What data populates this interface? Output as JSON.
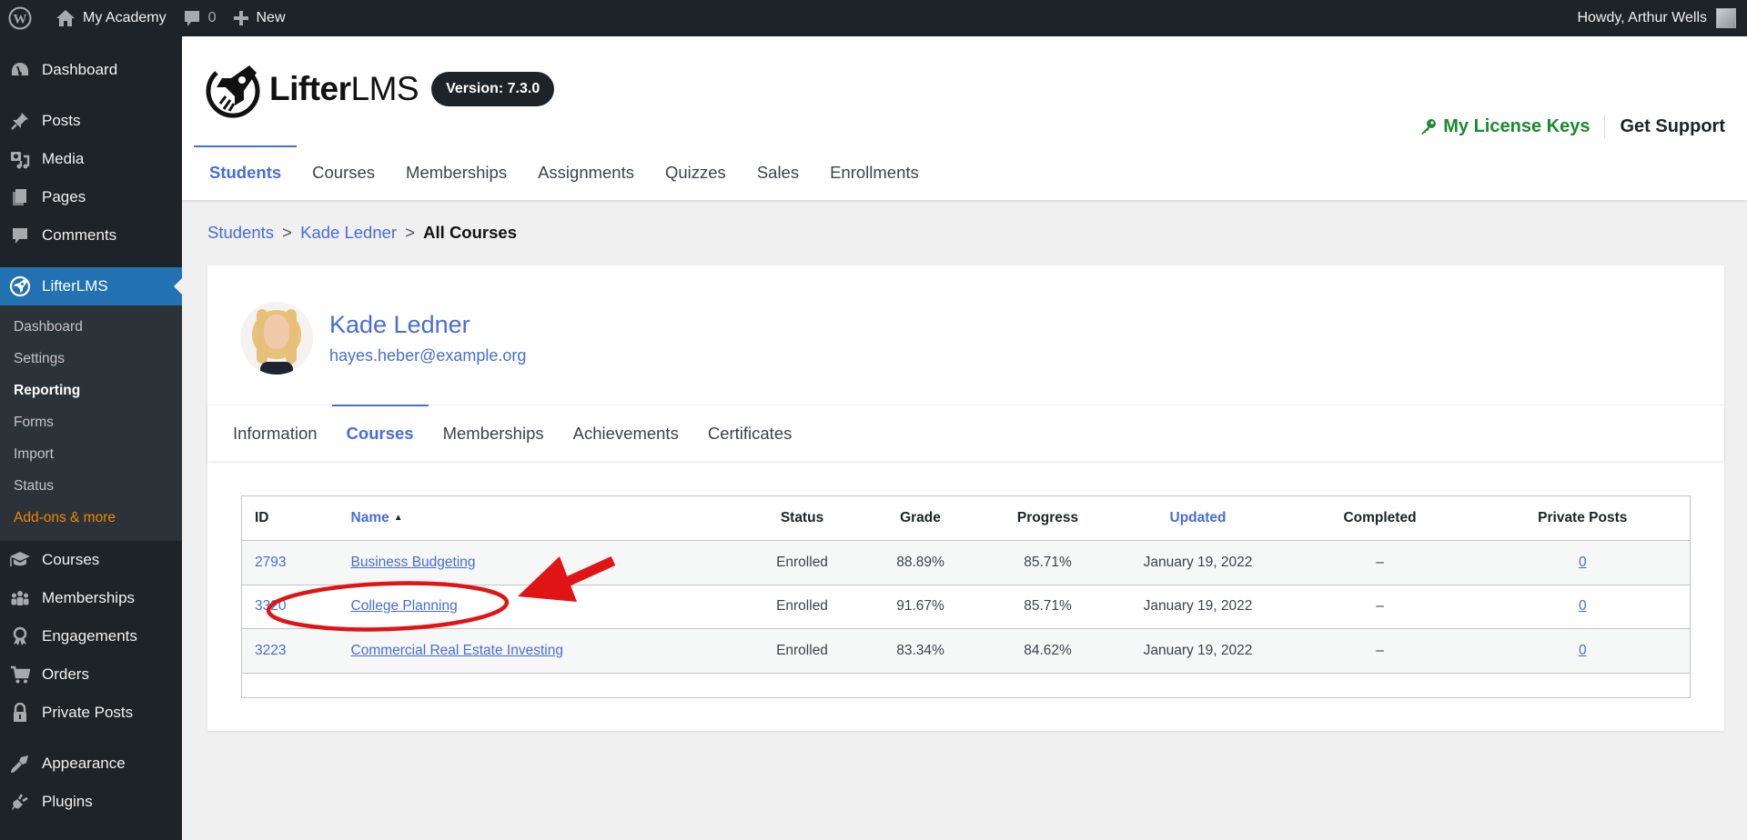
{
  "adminbar": {
    "site_name": "My Academy",
    "comments_count": "0",
    "new_label": "New",
    "howdy": "Howdy, Arthur Wells"
  },
  "sidebar": {
    "items": [
      {
        "label": "Dashboard",
        "icon": "dashboard-icon"
      },
      {
        "label": "Posts",
        "icon": "pushpin-icon"
      },
      {
        "label": "Media",
        "icon": "media-icon"
      },
      {
        "label": "Pages",
        "icon": "pages-icon"
      },
      {
        "label": "Comments",
        "icon": "comment-icon"
      },
      {
        "label": "LifterLMS",
        "icon": "lifterlms-rocket-icon",
        "active": true
      },
      {
        "label": "Courses",
        "icon": "graduation-cap-icon"
      },
      {
        "label": "Memberships",
        "icon": "groups-icon"
      },
      {
        "label": "Engagements",
        "icon": "award-icon"
      },
      {
        "label": "Orders",
        "icon": "cart-icon"
      },
      {
        "label": "Private Posts",
        "icon": "lock-icon"
      },
      {
        "label": "Appearance",
        "icon": "paintbrush-icon"
      },
      {
        "label": "Plugins",
        "icon": "plugin-icon"
      }
    ],
    "submenu": [
      "Dashboard",
      "Settings",
      "Reporting",
      "Forms",
      "Import",
      "Status",
      "Add-ons & more"
    ],
    "submenu_current": "Reporting"
  },
  "header": {
    "logo_bold": "Lifter",
    "logo_light": "LMS",
    "version": "Version: 7.3.0",
    "license_keys": "My License Keys",
    "get_support": "Get Support",
    "tabs": [
      "Students",
      "Courses",
      "Memberships",
      "Assignments",
      "Quizzes",
      "Sales",
      "Enrollments"
    ],
    "active_tab": "Students"
  },
  "breadcrumb": {
    "items": [
      "Students",
      "Kade Ledner"
    ],
    "separator": ">",
    "current": "All Courses"
  },
  "student": {
    "name": "Kade Ledner",
    "email": "hayes.heber@example.org",
    "tabs": [
      "Information",
      "Courses",
      "Memberships",
      "Achievements",
      "Certificates"
    ],
    "active_tab": "Courses"
  },
  "table": {
    "columns": [
      "ID",
      "Name",
      "Status",
      "Grade",
      "Progress",
      "Updated",
      "Completed",
      "Private Posts"
    ],
    "sort_indicator": "▲",
    "rows": [
      {
        "id": "2793",
        "name": "Business Budgeting",
        "status": "Enrolled",
        "grade": "88.89%",
        "progress": "85.71%",
        "updated": "January 19, 2022",
        "completed": "–",
        "private_posts": "0"
      },
      {
        "id": "3320",
        "name": "College Planning",
        "status": "Enrolled",
        "grade": "91.67%",
        "progress": "85.71%",
        "updated": "January 19, 2022",
        "completed": "–",
        "private_posts": "0"
      },
      {
        "id": "3223",
        "name": "Commercial Real Estate Investing",
        "status": "Enrolled",
        "grade": "83.34%",
        "progress": "84.62%",
        "updated": "January 19, 2022",
        "completed": "–",
        "private_posts": "0"
      }
    ]
  },
  "annotation": {
    "highlighted_item": "College Planning",
    "color": "#e01414"
  },
  "colors": {
    "accent": "#466dd8",
    "wp_blue": "#2271b1",
    "license_green": "#1a8a2e",
    "addons_orange": "#f18500"
  }
}
